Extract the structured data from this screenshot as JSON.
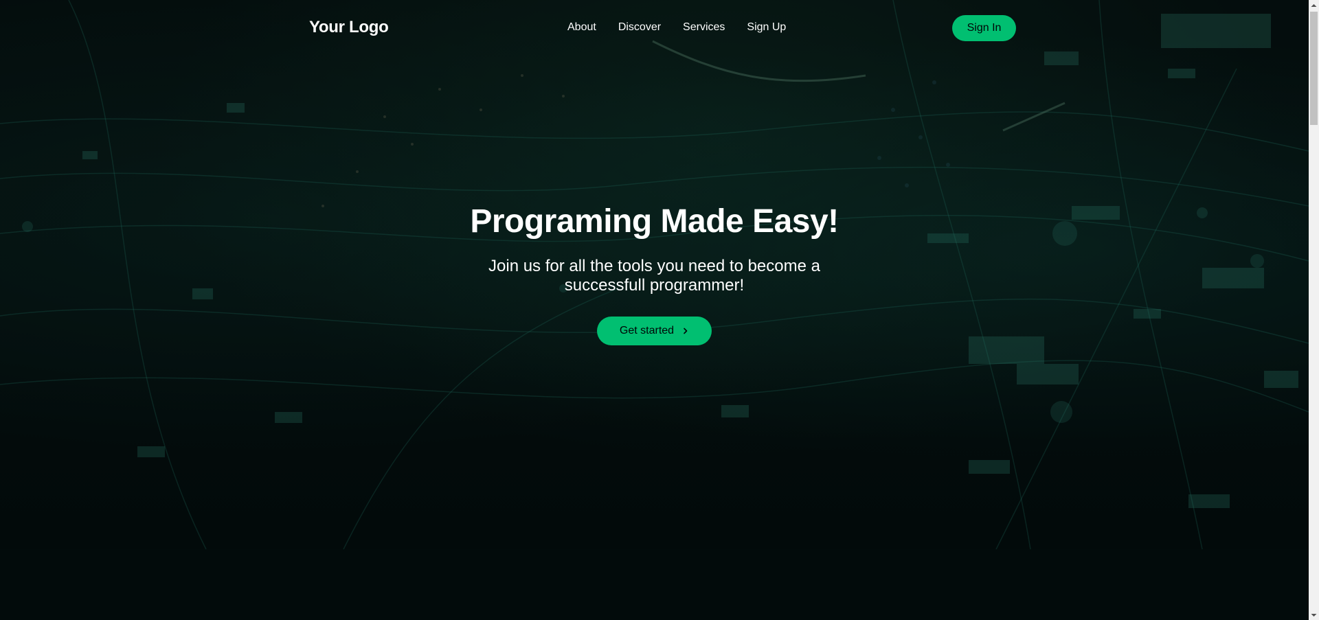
{
  "nav": {
    "logo": "Your Logo",
    "links": [
      "About",
      "Discover",
      "Services",
      "Sign Up"
    ],
    "signin_label": "Sign In"
  },
  "hero": {
    "title": "Programing Made Easy!",
    "subtitle": "Join us for all the tools you need to become a successfull programmer!",
    "cta_label": "Get started",
    "cta_icon": "chevron-right-icon"
  },
  "colors": {
    "accent": "#01bf71",
    "background": "#010606",
    "text": "#ffffff"
  }
}
